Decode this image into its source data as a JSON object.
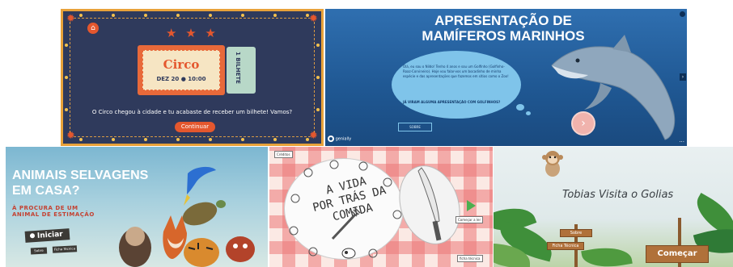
{
  "circo": {
    "ticket_title": "Circo",
    "ticket_date": "DEZ 20 ● 10:00",
    "stub_text": "1 BILHETE",
    "message": "O Circo chegou à cidade e tu acabaste de receber um bilhete! Vamos?",
    "button": "Continuar",
    "stars": "★ ★ ★",
    "home_icon": "⌂",
    "corner_icon": "✹",
    "colors": {
      "background": "#2f3a5c",
      "accent": "#e4572e",
      "frame": "#e8a23a"
    }
  },
  "mamiferos": {
    "title_line1": "APRESENTAÇÃO DE",
    "title_line2": "MAMÍFEROS MARINHOS",
    "bubble_text": "Olá, eu sou o Nildo! Tenho 4 anos e sou um Golfinho (Golfinho-Roaz-Corvineiro). Hoje vou falar-vos um bocadinho de minha espécie e das apresentações que fazemos em sítios como o Zoo!",
    "bubble_question": "JÁ VIRAM ALGUMA APRESENTAÇÃO COM GOLFINHOS?",
    "sobre_button": "SOBRE",
    "play_icon": "›",
    "logo_text": "genially",
    "arrow_icon": "›",
    "more_icon": "···",
    "colors": {
      "background": "#1f5792",
      "bubble": "#7fc4ea",
      "play": "#f0b3ad"
    }
  },
  "animais": {
    "title_line1": "ANIMAIS SELVAGENS",
    "title_line2": "EM CASA?",
    "subtitle_line1": "À PROCURA DE UM",
    "subtitle_line2": "ANIMAL DE ESTIMAÇÃO",
    "start_button": "Iniciar",
    "button_sobre": "Sobre",
    "button_ficha": "Ficha Técnica",
    "colors": {
      "accent": "#c44232",
      "button": "#3c3a36"
    }
  },
  "vida": {
    "plate_title_line1": "A VIDA",
    "plate_title_line2": "POR TRÁS DA",
    "plate_title_line3": "COMIDA",
    "label_top": "Créditos",
    "label_play": "Começar a ler",
    "label_bottom": "ficha técnica",
    "colors": {
      "check": "#ec7878",
      "play": "#4caf50"
    }
  },
  "tobias": {
    "title": "Tobias Visita o Golias",
    "sign_sobre": "Sobre",
    "sign_ficha": "Ficha Técnica",
    "sign_start": "Começar",
    "colors": {
      "wood": "#b0713a",
      "leaves": "#3f8f3a"
    }
  }
}
